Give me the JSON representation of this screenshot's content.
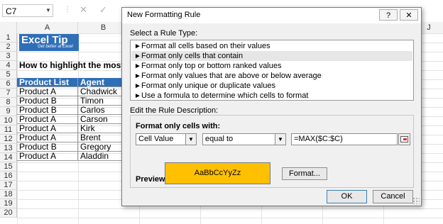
{
  "formula_bar": {
    "name_box": "C7",
    "cancel_icon": "✕",
    "enter_icon": "✓"
  },
  "sheet": {
    "columns": [
      "A",
      "B"
    ],
    "extra_column": "J",
    "rows": [
      "1",
      "2",
      "3",
      "4",
      "5",
      "6",
      "7",
      "8",
      "9",
      "10",
      "11",
      "12",
      "13",
      "14",
      "15",
      "16",
      "17",
      "18",
      "19",
      "20"
    ],
    "logo": {
      "main": "Excel Tip",
      "sub": "Get better at Excel"
    },
    "heading": "How to highlight the most",
    "table": {
      "headers": [
        "Product List",
        "Agent"
      ],
      "rows": [
        [
          "Product A",
          "Chadwick"
        ],
        [
          "Product B",
          "Timon"
        ],
        [
          "Product B",
          "Carlos"
        ],
        [
          "Product A",
          "Carson"
        ],
        [
          "Product A",
          "Kirk"
        ],
        [
          "Product A",
          "Brent"
        ],
        [
          "Product B",
          "Gregory"
        ],
        [
          "Product A",
          "Aladdin"
        ]
      ]
    },
    "header_color": "#2f6fb8"
  },
  "dialog": {
    "title": "New Formatting Rule",
    "help_label": "?",
    "close_label": "✕",
    "select_type_label": "Select a Rule Type:",
    "rule_types": [
      "Format all cells based on their values",
      "Format only cells that contain",
      "Format only top or bottom ranked values",
      "Format only values that are above or below average",
      "Format only unique or duplicate values",
      "Use a formula to determine which cells to format"
    ],
    "selected_rule_index": 1,
    "edit_desc_label": "Edit the Rule Description:",
    "format_only_label": "Format only cells with:",
    "condition_type": "Cell Value",
    "operator": "equal to",
    "formula": "=MAX($C:$C)",
    "preview_label": "Preview:",
    "preview_text": "AaBbCcYyZz",
    "preview_fill": "#ffc000",
    "format_button": "Format...",
    "ok_button": "OK",
    "cancel_button": "Cancel"
  }
}
